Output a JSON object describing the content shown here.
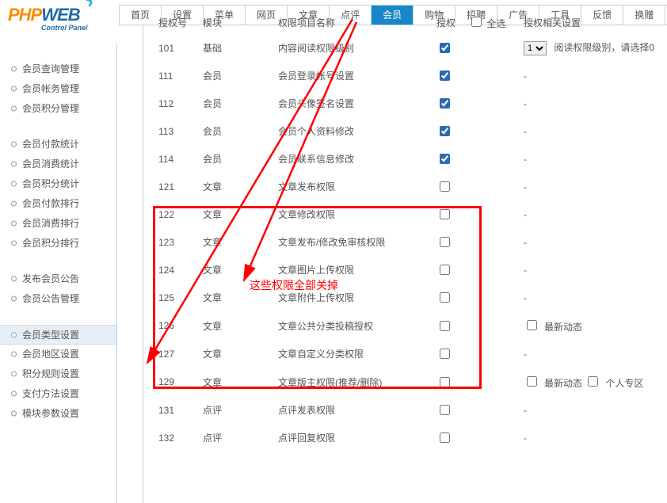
{
  "logo": {
    "part1": "PHP",
    "part2": "WEB",
    "sub": "Control Panel"
  },
  "topnav": {
    "items": [
      "首页",
      "设置",
      "菜单",
      "网页",
      "文章",
      "点评",
      "会员",
      "购物",
      "招聘",
      "广告",
      "工具",
      "反馈",
      "换赠"
    ],
    "active_index": 6
  },
  "sidebar": {
    "groups": [
      {
        "items": [
          "会员查询管理",
          "会员帐务管理",
          "会员积分管理"
        ],
        "selected": -1
      },
      {
        "items": [
          "会员付款统计",
          "会员消费统计",
          "会员积分统计",
          "会员付款排行",
          "会员消费排行",
          "会员积分排行"
        ],
        "selected": -1
      },
      {
        "items": [
          "发布会员公告",
          "会员公告管理"
        ],
        "selected": -1
      },
      {
        "items": [
          "会员类型设置",
          "会员地区设置",
          "积分规则设置",
          "支付方法设置",
          "模块参数设置"
        ],
        "selected": 0
      }
    ]
  },
  "columns": {
    "id": "授权号",
    "module": "模块",
    "name": "权限项目名称",
    "auth": "授权",
    "all": "全选",
    "extra": "授权相关设置"
  },
  "select_options": [
    "1"
  ],
  "rows": [
    {
      "id": "101",
      "mod": "基础",
      "name": "内容阅读权限级别",
      "checked": true,
      "extra_select": "1",
      "extra_text": "阅读权限级别，请选择0"
    },
    {
      "id": "111",
      "mod": "会员",
      "name": "会员登录帐号设置",
      "checked": true,
      "extra_text": "-"
    },
    {
      "id": "112",
      "mod": "会员",
      "name": "会员头像签名设置",
      "checked": true,
      "extra_text": "-"
    },
    {
      "id": "113",
      "mod": "会员",
      "name": "会员个人资料修改",
      "checked": true,
      "extra_text": "-"
    },
    {
      "id": "114",
      "mod": "会员",
      "name": "会员联系信息修改",
      "checked": true,
      "extra_text": "-"
    },
    {
      "id": "121",
      "mod": "文章",
      "name": "文章发布权限",
      "checked": false,
      "extra_text": "-"
    },
    {
      "id": "122",
      "mod": "文章",
      "name": "文章修改权限",
      "checked": false,
      "extra_text": "-"
    },
    {
      "id": "123",
      "mod": "文章",
      "name": "文章发布/修改免审核权限",
      "checked": false,
      "extra_text": "-"
    },
    {
      "id": "124",
      "mod": "文章",
      "name": "文章图片上传权限",
      "checked": false,
      "extra_text": "-"
    },
    {
      "id": "125",
      "mod": "文章",
      "name": "文章附件上传权限",
      "checked": false,
      "extra_text": "-"
    },
    {
      "id": "126",
      "mod": "文章",
      "name": "文章公共分类投稿授权",
      "checked": false,
      "extra_checks": [
        {
          "label": "最新动态",
          "checked": false
        }
      ]
    },
    {
      "id": "127",
      "mod": "文章",
      "name": "文章自定义分类权限",
      "checked": false,
      "extra_text": "-"
    },
    {
      "id": "129",
      "mod": "文章",
      "name": "文章版主权限(推荐/删除)",
      "checked": false,
      "extra_checks": [
        {
          "label": "最新动态",
          "checked": false
        },
        {
          "label": "个人专区",
          "checked": false
        }
      ]
    },
    {
      "id": "131",
      "mod": "点评",
      "name": "点评发表权限",
      "checked": false,
      "extra_text": "-"
    },
    {
      "id": "132",
      "mod": "点评",
      "name": "点评回复权限",
      "checked": false,
      "extra_text": "-"
    }
  ],
  "annotations": {
    "remove_perms": "这些权限全部关掉"
  }
}
